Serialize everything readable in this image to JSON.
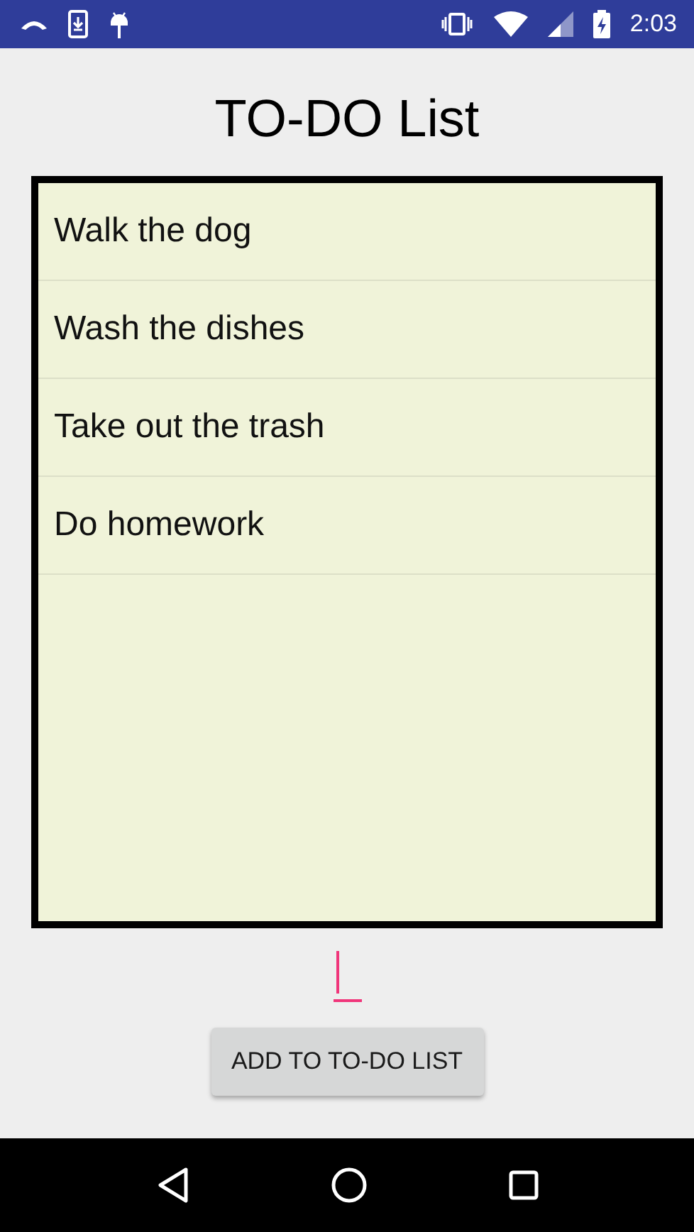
{
  "status_bar": {
    "time": "2:03"
  },
  "title": "TO-DO List",
  "items": [
    {
      "text": "Walk the dog"
    },
    {
      "text": "Wash the dishes"
    },
    {
      "text": "Take out the trash"
    },
    {
      "text": "Do homework"
    }
  ],
  "input": {
    "focused": true
  },
  "button": {
    "label": "ADD TO TO-DO LIST"
  }
}
